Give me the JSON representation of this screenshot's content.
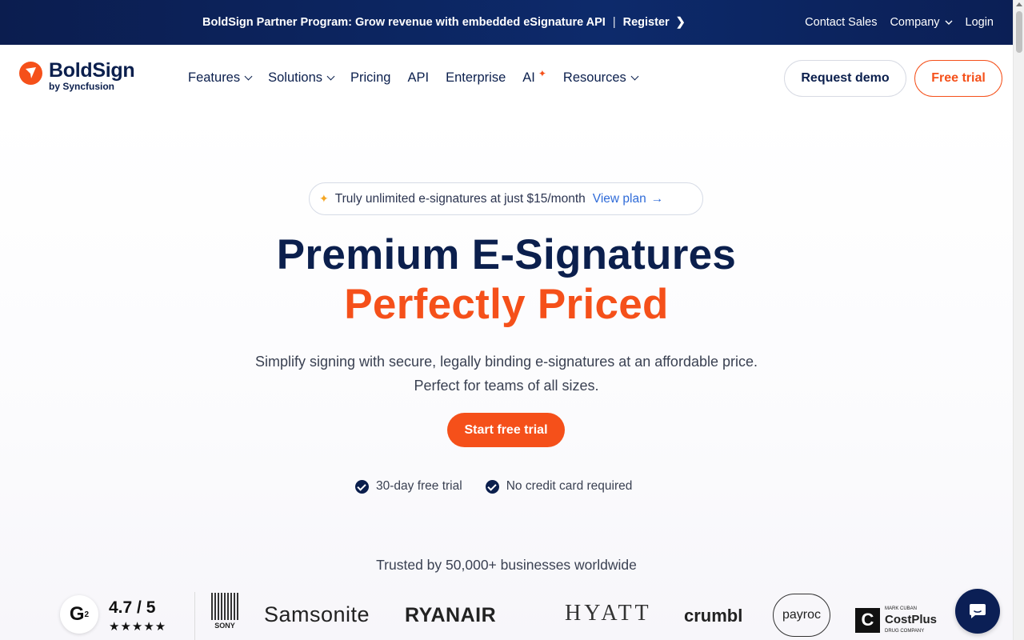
{
  "banner": {
    "promo_text": "BoldSign Partner Program: Grow revenue with embedded eSignature API",
    "separator": "|",
    "register_label": "Register",
    "register_arrow": "❯",
    "contact_sales": "Contact Sales",
    "company": "Company",
    "login": "Login"
  },
  "brand": {
    "name": "BoldSign",
    "byline": "by Syncfusion",
    "accent_color": "#f5501a",
    "navy_color": "#0b1f4d"
  },
  "nav": {
    "items": [
      {
        "label": "Features",
        "dropdown": true
      },
      {
        "label": "Solutions",
        "dropdown": true
      },
      {
        "label": "Pricing",
        "dropdown": false
      },
      {
        "label": "API",
        "dropdown": false
      },
      {
        "label": "Enterprise",
        "dropdown": false
      },
      {
        "label": "AI",
        "dropdown": false
      },
      {
        "label": "Resources",
        "dropdown": true
      }
    ],
    "request_demo": "Request demo",
    "free_trial": "Free trial"
  },
  "hero": {
    "pill_text": "Truly unlimited e-signatures at just $15/month",
    "pill_link": "View plan",
    "pill_arrow": "→",
    "title_line1": "Premium E-Signatures",
    "title_line2": "Perfectly Priced",
    "subtitle_line1": "Simplify signing with secure, legally binding e-signatures at an affordable price.",
    "subtitle_line2": "Perfect for teams of all sizes.",
    "cta": "Start free trial",
    "check1": "30-day free trial",
    "check2": "No credit card required",
    "trusted": "Trusted by 50,000+ businesses worldwide"
  },
  "proof": {
    "g2_label": "G",
    "g2_sup": "2",
    "rating": "4.7 / 5",
    "stars": "★★★★★",
    "logos": {
      "sony": "SONY",
      "samsonite": "Samsonite",
      "ryanair": "RYANAIR",
      "hyatt": "HYATT",
      "crumbl": "crumbl",
      "payroc": "payroc",
      "costplus_mark": "C",
      "costplus_small": "MARK CUBAN",
      "costplus_name": "CostPlus",
      "costplus_sub": "DRUG COMPANY"
    }
  }
}
